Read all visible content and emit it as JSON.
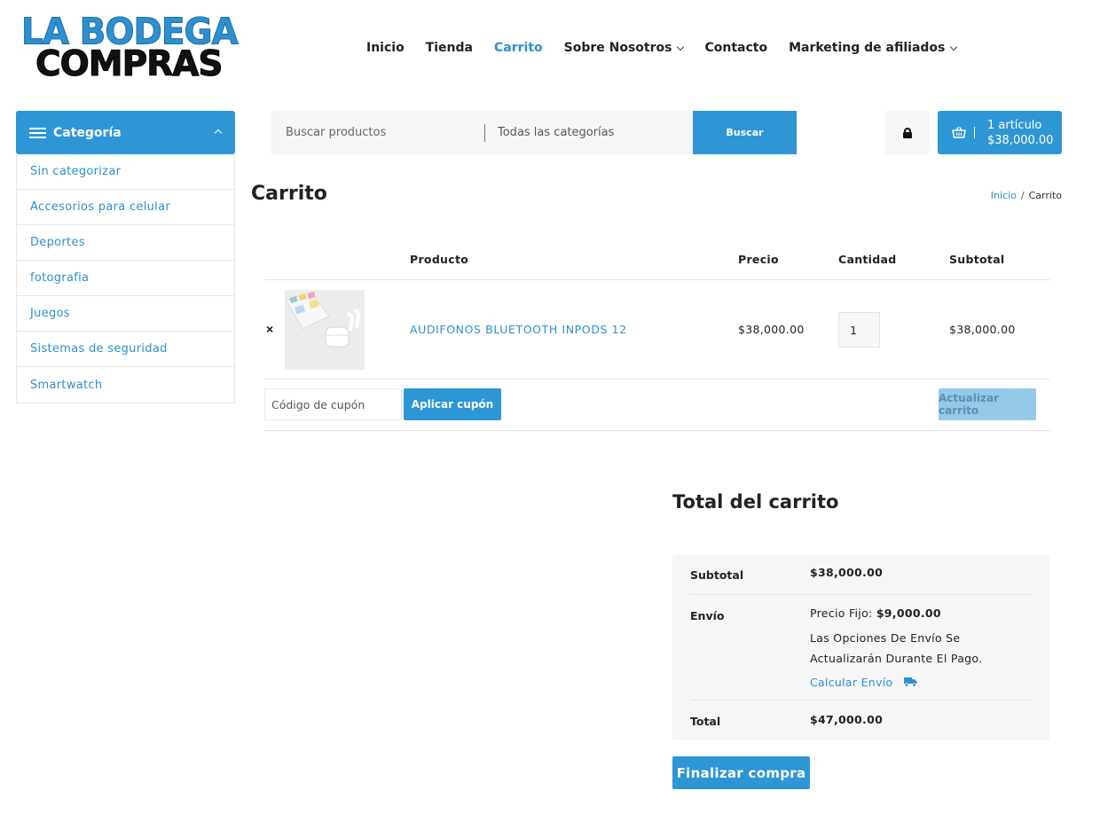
{
  "brand": {
    "line1": "LA BODEGA",
    "line2": "COMPRAS",
    "color_primary": "#2e8fd0",
    "color_dark": "#111111"
  },
  "nav": {
    "items": [
      {
        "label": "Inicio"
      },
      {
        "label": "Tienda"
      },
      {
        "label": "Carrito",
        "active": true
      },
      {
        "label": "Sobre Nosotros",
        "dropdown": true
      },
      {
        "label": "Contacto"
      },
      {
        "label": "Marketing de afiliados",
        "dropdown": true
      }
    ]
  },
  "sidebar": {
    "title": "Categoría",
    "items": [
      {
        "label": "Sin categorizar"
      },
      {
        "label": "Accesorios para celular"
      },
      {
        "label": "Deportes"
      },
      {
        "label": "fotografia"
      },
      {
        "label": "Juegos"
      },
      {
        "label": "Sistemas de seguridad"
      },
      {
        "label": "Smartwatch"
      }
    ]
  },
  "search": {
    "placeholder": "Buscar productos",
    "category_select": "Todas las categorías",
    "button_label": "Buscar"
  },
  "header_cart": {
    "count_label": "1 artículo",
    "total": "$38,000.00"
  },
  "page": {
    "title": "Carrito",
    "breadcrumb": {
      "home": "Inicio",
      "separator": "/",
      "current": "Carrito"
    }
  },
  "cart_table": {
    "headers": {
      "product": "Producto",
      "price": "Precio",
      "quantity": "Cantidad",
      "subtotal": "Subtotal"
    },
    "rows": [
      {
        "remove": "×",
        "name": "AUDIFONOS BLUETOOTH INPODS 12",
        "price": "$38,000.00",
        "quantity": "1",
        "subtotal": "$38,000.00"
      }
    ],
    "coupon_placeholder": "Código de cupón",
    "apply_coupon_label": "Aplicar cupón",
    "update_cart_label": "Actualizar carrito"
  },
  "totals": {
    "title": "Total del carrito",
    "subtotal_label": "Subtotal",
    "subtotal_value": "$38,000.00",
    "shipping_label": "Envío",
    "shipping_method_label": "Precio Fijo: ",
    "shipping_method_value": "$9,000.00",
    "shipping_note_line1": "Las Opciones De Envío Se",
    "shipping_note_line2": "Actualizarán Durante El Pago.",
    "calc_shipping_label": "Calcular Envío",
    "total_label": "Total",
    "total_value": "$47,000.00",
    "checkout_label": "Finalizar compra"
  },
  "icons": {
    "menu": "hamburger-icon",
    "collapse": "chevron-up-icon",
    "lock": "lock-icon",
    "cart": "basket-icon",
    "shipping": "truck-icon"
  }
}
